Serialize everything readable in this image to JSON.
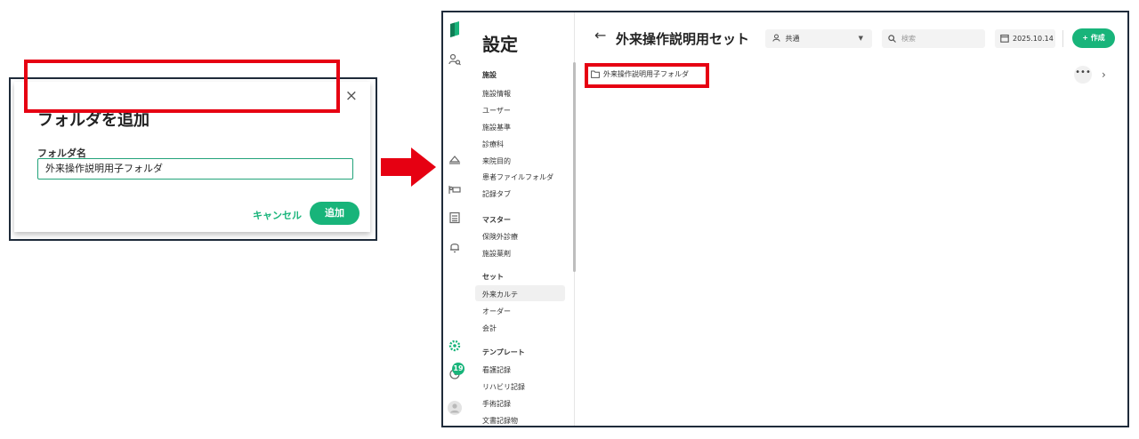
{
  "dialog": {
    "title": "フォルダを追加",
    "close_symbol": "×",
    "field_label": "フォルダ名",
    "field_value": "外来操作説明用子フォルダ",
    "cancel_label": "キャンセル",
    "add_label": "追加"
  },
  "sidebar": {
    "heading": "設定",
    "sections": [
      {
        "title": "施設",
        "items": [
          "施設情報",
          "ユーザー",
          "施設基準",
          "診療科",
          "来院目的",
          "患者ファイルフォルダ",
          "記録タブ"
        ]
      },
      {
        "title": "マスター",
        "items": [
          "保険外診療",
          "施設薬剤"
        ]
      },
      {
        "title": "セット",
        "items": [
          "外来カルテ",
          "オーダー",
          "会計"
        ]
      },
      {
        "title": "テンプレート",
        "items": [
          "看護記録",
          "リハビリ記録",
          "手術記録",
          "文書記録物"
        ]
      }
    ],
    "active_item": "外来カルテ"
  },
  "rail": {
    "icons": [
      "logo-icon",
      "user-search-icon",
      "hat-icon",
      "bed-icon",
      "document-icon",
      "bell-icon",
      "settings-icon",
      "history-icon",
      "avatar-icon"
    ],
    "badge_count": "19"
  },
  "header": {
    "back_symbol": "←",
    "title": "外来操作説明用セット",
    "scope_value": "共通",
    "search_placeholder": "検索",
    "date": "2025.10.14",
    "create_label": "+ 作成"
  },
  "content": {
    "folder_name": "外来操作説明用子フォルダ",
    "more_symbol": "•••",
    "chevron_symbol": "›"
  },
  "colors": {
    "accent": "#18b47a",
    "highlight": "#e60012",
    "arrow": "#e60012",
    "frame": "#1f2b3a"
  }
}
